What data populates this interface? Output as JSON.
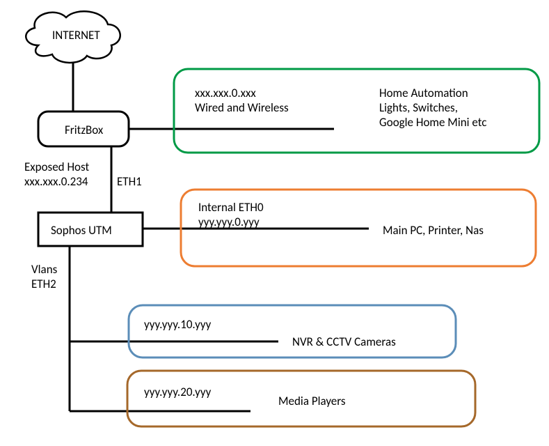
{
  "internet": {
    "label": "INTERNET"
  },
  "fritzbox": {
    "label": "FritzBox"
  },
  "sophos": {
    "label": "Sophos UTM"
  },
  "exposed_host": {
    "line1": "Exposed Host",
    "line2": "xxx.xxx.0.234"
  },
  "eth1": {
    "label": "ETH1"
  },
  "vlans": {
    "line1": "Vlans",
    "line2": "ETH2"
  },
  "green_box": {
    "subnet_line1": "xxx.xxx.0.xxx",
    "subnet_line2": "Wired and Wireless",
    "desc_line1": "Home Automation",
    "desc_line2": "Lights, Switches,",
    "desc_line3": "Google Home Mini etc"
  },
  "orange_box": {
    "subnet_line1": "Internal ETH0",
    "subnet_line2": "yyy.yyy.0.yyy",
    "desc": "Main PC, Printer, Nas"
  },
  "blue_box": {
    "subnet": "yyy.yyy.10.yyy",
    "desc": "NVR & CCTV Cameras"
  },
  "brown_box": {
    "subnet": "yyy.yyy.20.yyy",
    "desc": "Media Players"
  }
}
